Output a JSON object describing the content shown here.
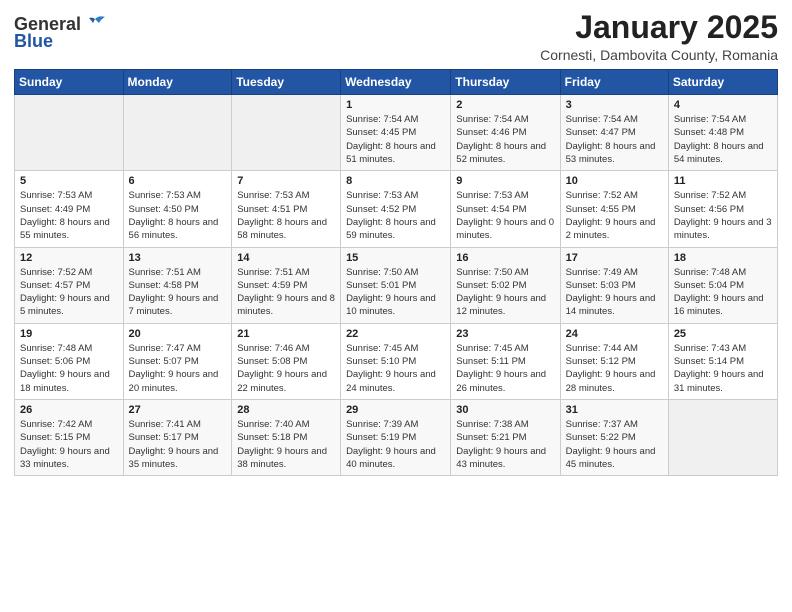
{
  "logo": {
    "general": "General",
    "blue": "Blue"
  },
  "header": {
    "month": "January 2025",
    "location": "Cornesti, Dambovita County, Romania"
  },
  "days_of_week": [
    "Sunday",
    "Monday",
    "Tuesday",
    "Wednesday",
    "Thursday",
    "Friday",
    "Saturday"
  ],
  "weeks": [
    [
      {
        "day": "",
        "info": ""
      },
      {
        "day": "",
        "info": ""
      },
      {
        "day": "",
        "info": ""
      },
      {
        "day": "1",
        "info": "Sunrise: 7:54 AM\nSunset: 4:45 PM\nDaylight: 8 hours and 51 minutes."
      },
      {
        "day": "2",
        "info": "Sunrise: 7:54 AM\nSunset: 4:46 PM\nDaylight: 8 hours and 52 minutes."
      },
      {
        "day": "3",
        "info": "Sunrise: 7:54 AM\nSunset: 4:47 PM\nDaylight: 8 hours and 53 minutes."
      },
      {
        "day": "4",
        "info": "Sunrise: 7:54 AM\nSunset: 4:48 PM\nDaylight: 8 hours and 54 minutes."
      }
    ],
    [
      {
        "day": "5",
        "info": "Sunrise: 7:53 AM\nSunset: 4:49 PM\nDaylight: 8 hours and 55 minutes."
      },
      {
        "day": "6",
        "info": "Sunrise: 7:53 AM\nSunset: 4:50 PM\nDaylight: 8 hours and 56 minutes."
      },
      {
        "day": "7",
        "info": "Sunrise: 7:53 AM\nSunset: 4:51 PM\nDaylight: 8 hours and 58 minutes."
      },
      {
        "day": "8",
        "info": "Sunrise: 7:53 AM\nSunset: 4:52 PM\nDaylight: 8 hours and 59 minutes."
      },
      {
        "day": "9",
        "info": "Sunrise: 7:53 AM\nSunset: 4:54 PM\nDaylight: 9 hours and 0 minutes."
      },
      {
        "day": "10",
        "info": "Sunrise: 7:52 AM\nSunset: 4:55 PM\nDaylight: 9 hours and 2 minutes."
      },
      {
        "day": "11",
        "info": "Sunrise: 7:52 AM\nSunset: 4:56 PM\nDaylight: 9 hours and 3 minutes."
      }
    ],
    [
      {
        "day": "12",
        "info": "Sunrise: 7:52 AM\nSunset: 4:57 PM\nDaylight: 9 hours and 5 minutes."
      },
      {
        "day": "13",
        "info": "Sunrise: 7:51 AM\nSunset: 4:58 PM\nDaylight: 9 hours and 7 minutes."
      },
      {
        "day": "14",
        "info": "Sunrise: 7:51 AM\nSunset: 4:59 PM\nDaylight: 9 hours and 8 minutes."
      },
      {
        "day": "15",
        "info": "Sunrise: 7:50 AM\nSunset: 5:01 PM\nDaylight: 9 hours and 10 minutes."
      },
      {
        "day": "16",
        "info": "Sunrise: 7:50 AM\nSunset: 5:02 PM\nDaylight: 9 hours and 12 minutes."
      },
      {
        "day": "17",
        "info": "Sunrise: 7:49 AM\nSunset: 5:03 PM\nDaylight: 9 hours and 14 minutes."
      },
      {
        "day": "18",
        "info": "Sunrise: 7:48 AM\nSunset: 5:04 PM\nDaylight: 9 hours and 16 minutes."
      }
    ],
    [
      {
        "day": "19",
        "info": "Sunrise: 7:48 AM\nSunset: 5:06 PM\nDaylight: 9 hours and 18 minutes."
      },
      {
        "day": "20",
        "info": "Sunrise: 7:47 AM\nSunset: 5:07 PM\nDaylight: 9 hours and 20 minutes."
      },
      {
        "day": "21",
        "info": "Sunrise: 7:46 AM\nSunset: 5:08 PM\nDaylight: 9 hours and 22 minutes."
      },
      {
        "day": "22",
        "info": "Sunrise: 7:45 AM\nSunset: 5:10 PM\nDaylight: 9 hours and 24 minutes."
      },
      {
        "day": "23",
        "info": "Sunrise: 7:45 AM\nSunset: 5:11 PM\nDaylight: 9 hours and 26 minutes."
      },
      {
        "day": "24",
        "info": "Sunrise: 7:44 AM\nSunset: 5:12 PM\nDaylight: 9 hours and 28 minutes."
      },
      {
        "day": "25",
        "info": "Sunrise: 7:43 AM\nSunset: 5:14 PM\nDaylight: 9 hours and 31 minutes."
      }
    ],
    [
      {
        "day": "26",
        "info": "Sunrise: 7:42 AM\nSunset: 5:15 PM\nDaylight: 9 hours and 33 minutes."
      },
      {
        "day": "27",
        "info": "Sunrise: 7:41 AM\nSunset: 5:17 PM\nDaylight: 9 hours and 35 minutes."
      },
      {
        "day": "28",
        "info": "Sunrise: 7:40 AM\nSunset: 5:18 PM\nDaylight: 9 hours and 38 minutes."
      },
      {
        "day": "29",
        "info": "Sunrise: 7:39 AM\nSunset: 5:19 PM\nDaylight: 9 hours and 40 minutes."
      },
      {
        "day": "30",
        "info": "Sunrise: 7:38 AM\nSunset: 5:21 PM\nDaylight: 9 hours and 43 minutes."
      },
      {
        "day": "31",
        "info": "Sunrise: 7:37 AM\nSunset: 5:22 PM\nDaylight: 9 hours and 45 minutes."
      },
      {
        "day": "",
        "info": ""
      }
    ]
  ]
}
